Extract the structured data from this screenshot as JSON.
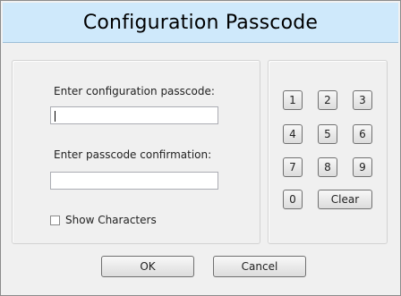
{
  "window": {
    "title": "Configuration Passcode"
  },
  "form": {
    "passcode_label": "Enter configuration passcode:",
    "passcode_value": "",
    "confirm_label": "Enter passcode confirmation:",
    "confirm_value": "",
    "show_characters_label": "Show Characters",
    "show_characters_checked": false
  },
  "keypad": {
    "keys": [
      "1",
      "2",
      "3",
      "4",
      "5",
      "6",
      "7",
      "8",
      "9",
      "0"
    ],
    "clear_label": "Clear"
  },
  "buttons": {
    "ok_label": "OK",
    "cancel_label": "Cancel"
  }
}
